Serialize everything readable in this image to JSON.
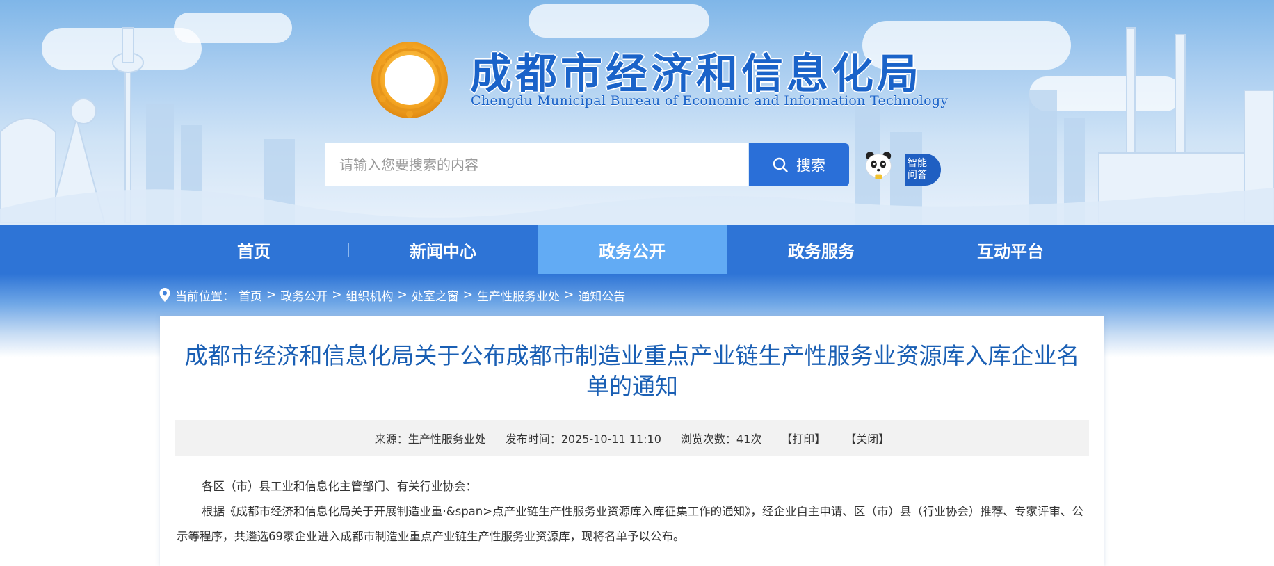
{
  "header": {
    "title_cn": "成都市经济和信息化局",
    "title_en": "Chengdu Municipal Bureau of Economic and Information Technology",
    "search": {
      "placeholder": "请输入您要搜索的内容",
      "button_label": "搜索"
    },
    "assistant": {
      "line1": "智能",
      "line2": "问答"
    }
  },
  "nav": {
    "items": [
      {
        "label": "首页"
      },
      {
        "label": "新闻中心"
      },
      {
        "label": "政务公开"
      },
      {
        "label": "政务服务"
      },
      {
        "label": "互动平台"
      }
    ],
    "active_index": 2
  },
  "breadcrumb": {
    "prefix": "当前位置：",
    "separator": ">",
    "items": [
      "首页",
      "政务公开",
      "组织机构",
      "处室之窗",
      "生产性服务业处",
      "通知公告"
    ]
  },
  "article": {
    "title": "成都市经济和信息化局关于公布成都市制造业重点产业链生产性服务业资源库入库企业名单的通知",
    "meta": {
      "source": "来源：生产性服务业处",
      "published": "发布时间：2025-10-11 11:10",
      "views": "浏览次数：41次",
      "print_label": "【打印】",
      "close_label": "【关闭】"
    },
    "paragraphs": [
      "各区（市）县工业和信息化主管部门、有关行业协会：",
      "根据《成都市经济和信息化局关于开展制造业重·&span>点产业链生产性服务业资源库入库征集工作的通知》，经企业自主申请、区（市）县（行业协会）推荐、专家评审、公示等程序，共遴选69家企业进入成都市制造业重点产业链生产性服务业资源库，现将名单予以公布。"
    ]
  },
  "colors": {
    "brand_blue": "#1a63c9",
    "nav_blue": "#2e74d6",
    "nav_active": "#62abf4",
    "search_button": "#2a6fd8",
    "title_blue": "#1a5fb4"
  }
}
